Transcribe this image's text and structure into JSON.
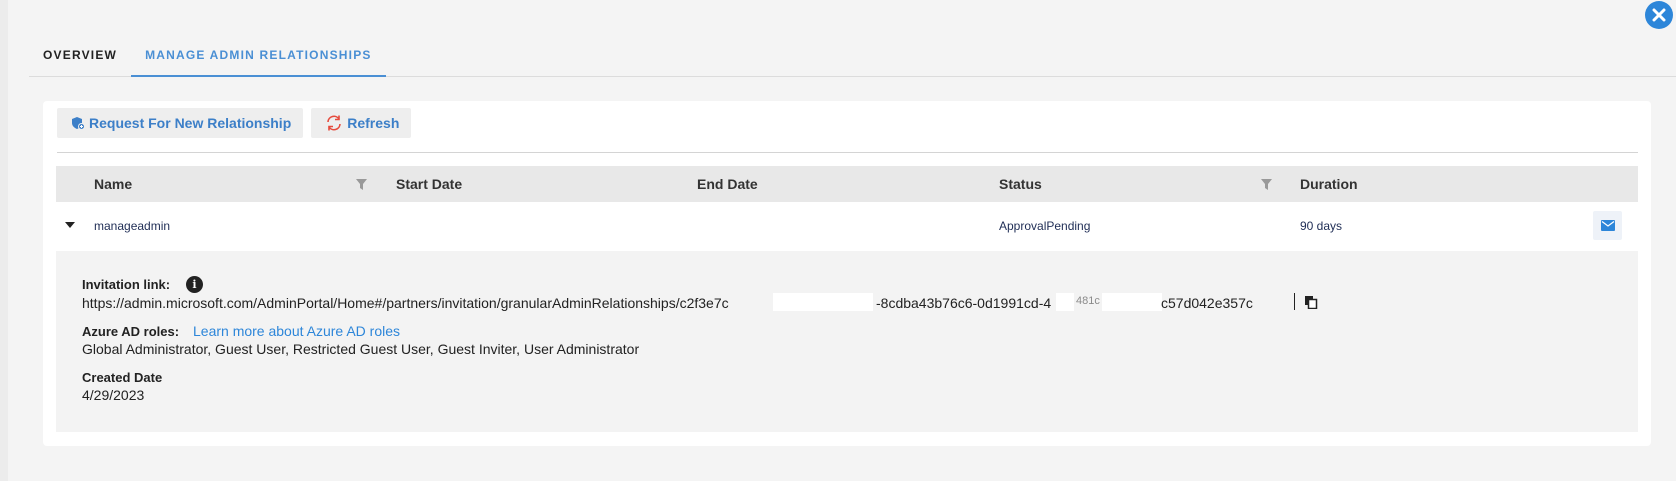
{
  "tabs": [
    {
      "label": "OVERVIEW"
    },
    {
      "label": "MANAGE ADMIN RELATIONSHIPS"
    }
  ],
  "toolbar": {
    "request_label": "Request For New Relationship",
    "refresh_label": "Refresh"
  },
  "table": {
    "columns": [
      "Name",
      "Start Date",
      "End Date",
      "Status",
      "Duration"
    ],
    "rows": [
      {
        "name": "manageadmin",
        "start_date": "",
        "end_date": "",
        "status": "ApprovalPending",
        "duration": "90 days"
      }
    ]
  },
  "details": {
    "invitation_label": "Invitation link:",
    "invitation_link": "https://admin.microsoft.com/AdminPortal/Home#/partners/invitation/granularAdminRelationships/c2f3e7c",
    "invitation_link_mid": "-8cdba43b76c6-0d1991cd-4",
    "invitation_link_mid2": "481c",
    "invitation_link_end": "c57d042e357c",
    "roles_label": "Azure AD roles:",
    "roles_link": "Learn more about Azure AD roles",
    "roles_value": "Global Administrator, Guest User, Restricted Guest User, Guest Inviter, User Administrator",
    "created_label": "Created Date",
    "created_value": "4/29/2023"
  },
  "colors": {
    "accent": "#2d86d9",
    "tab_active": "#4a8fd4"
  }
}
